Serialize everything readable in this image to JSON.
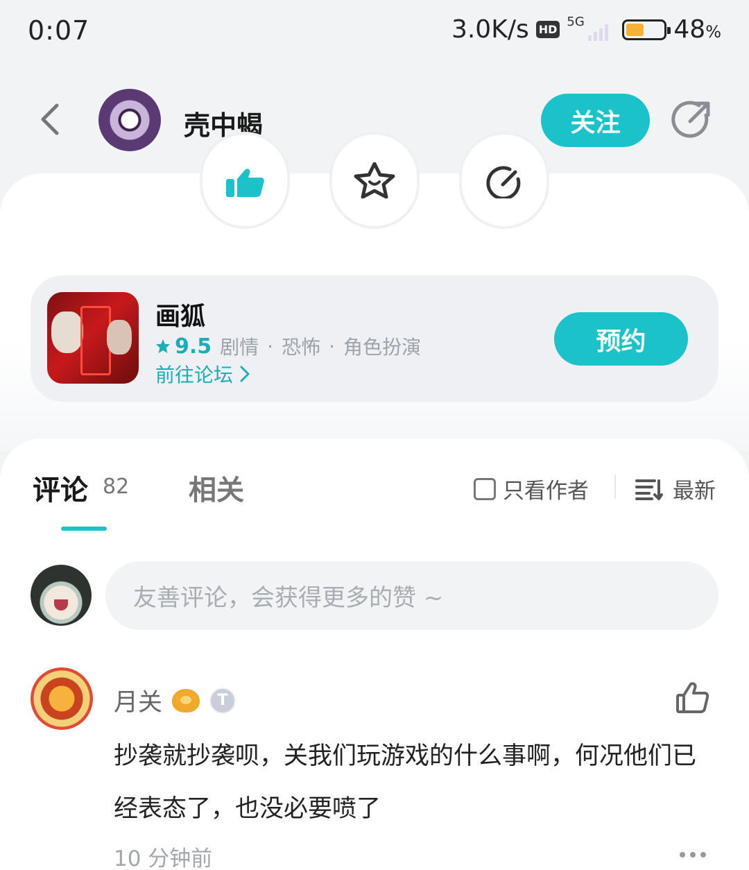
{
  "status_bar": {
    "time": "0:07",
    "net_speed": "3.0K/s",
    "hd": "HD",
    "network": "5G",
    "battery_level": 0.48,
    "battery_percent": "48",
    "battery_unit": "%"
  },
  "header": {
    "author_name": "壳中蝎",
    "follow_label": "关注"
  },
  "game": {
    "name": "画狐",
    "rating": "9.5",
    "tags": [
      "剧情",
      "恐怖",
      "角色扮演"
    ],
    "separator": "·",
    "forum_link": "前往论坛",
    "reserve_label": "预约"
  },
  "comments": {
    "tab_comments": "评论",
    "count": "82",
    "tab_related": "相关",
    "author_only": "只看作者",
    "sort": "最新",
    "input_placeholder": "友善评论，会获得更多的赞 ~",
    "items": [
      {
        "user": "月关",
        "badge": "T",
        "text": "抄袭就抄袭呗，关我们玩游戏的什么事啊，何况他们已经表态了，也没必要喷了",
        "time": "10 分钟前"
      }
    ]
  },
  "colors": {
    "accent": "#1cc2c9",
    "accent_text": "#1aaeb7",
    "battery": "#f4b336"
  }
}
